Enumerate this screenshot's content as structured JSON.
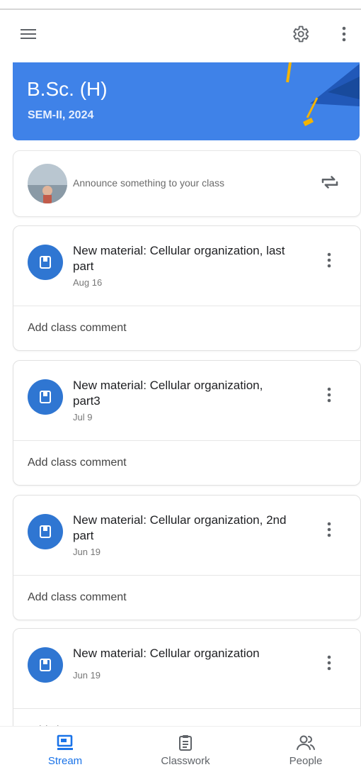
{
  "header": {
    "menu_icon": "menu-icon",
    "settings_icon": "gear-icon",
    "more_icon": "more-vert-icon"
  },
  "banner": {
    "title": "B.Sc. (H)",
    "subtitle": "SEM-II, 2024",
    "color": "#3f82e8"
  },
  "announce": {
    "placeholder": "Announce something to your class",
    "repost_icon": "repost-icon"
  },
  "posts": [
    {
      "title": "New material: Cellular organization, last part",
      "date": "Aug 16",
      "comment": "Add class comment"
    },
    {
      "title": "New material: Cellular organization, part3",
      "date": "Jul 9",
      "comment": "Add class comment"
    },
    {
      "title": "New material: Cellular organization, 2nd part",
      "date": "Jun 19",
      "comment": "Add class comment"
    },
    {
      "title": "New material: Cellular organization",
      "date": "Jun 19",
      "comment": "Add class comment"
    }
  ],
  "bottom_nav": {
    "items": [
      {
        "label": "Stream",
        "icon": "stream-icon",
        "active": true
      },
      {
        "label": "Classwork",
        "icon": "classwork-icon",
        "active": false
      },
      {
        "label": "People",
        "icon": "people-icon",
        "active": false
      }
    ]
  }
}
